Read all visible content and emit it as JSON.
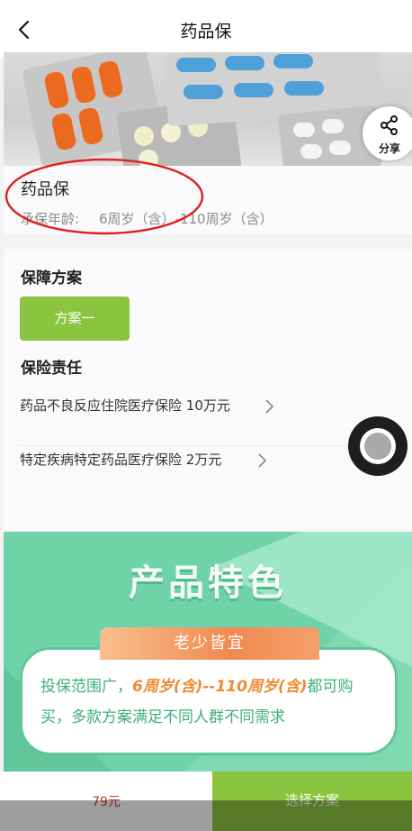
{
  "nav": {
    "title": "药品保"
  },
  "banner": {
    "share_label": "分享"
  },
  "product": {
    "name": "药品保",
    "age_label": "承保年龄:",
    "age_value": "6周岁（含）-110周岁（含）"
  },
  "plan": {
    "section_title": "保障方案",
    "option_label": "方案一",
    "responsibility_title": "保险责任",
    "responsibilities": [
      {
        "label": "药品不良反应住院医疗保险 10万元"
      },
      {
        "label": "特定疾病特定药品医疗保险 2万元"
      }
    ]
  },
  "feature": {
    "title": "产品特色",
    "ribbon": "老少皆宜",
    "line1_prefix": "投保范围广，",
    "line1_highlight": "6周岁(含)--110周岁(含)",
    "line1_suffix": "都可购",
    "line2": "买，多款方案满足不同人群不同需求"
  },
  "footer": {
    "price": "79元",
    "select_label": "选择方案"
  },
  "colors": {
    "accent_green": "#8bc540",
    "feature_green": "#7fd9b3",
    "highlight_orange": "#f08a33",
    "annotation_red": "#e02020"
  },
  "icons": [
    "back-arrow-icon",
    "share-icon",
    "chevron-right-icon",
    "floating-assist-icon"
  ]
}
